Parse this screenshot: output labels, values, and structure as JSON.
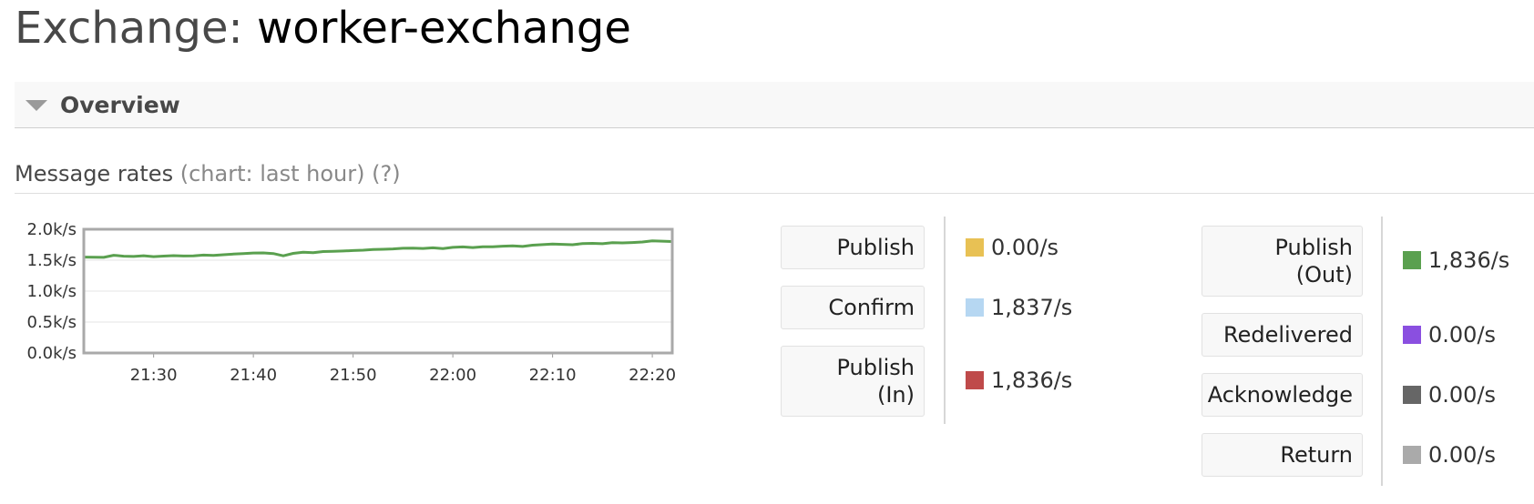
{
  "page": {
    "title_prefix": "Exchange:",
    "title_name": "worker-exchange"
  },
  "overview": {
    "label": "Overview"
  },
  "message_rates": {
    "label": "Message rates",
    "chart_hint": "(chart: last hour)",
    "help": "(?)"
  },
  "chart_data": {
    "type": "line",
    "x": [
      "21:23",
      "21:24",
      "21:25",
      "21:26",
      "21:27",
      "21:28",
      "21:29",
      "21:30",
      "21:31",
      "21:32",
      "21:33",
      "21:34",
      "21:35",
      "21:36",
      "21:37",
      "21:38",
      "21:39",
      "21:40",
      "21:41",
      "21:42",
      "21:43",
      "21:44",
      "21:45",
      "21:46",
      "21:47",
      "21:48",
      "21:49",
      "21:50",
      "21:51",
      "21:52",
      "21:53",
      "21:54",
      "21:55",
      "21:56",
      "21:57",
      "21:58",
      "21:59",
      "22:00",
      "22:01",
      "22:02",
      "22:03",
      "22:04",
      "22:05",
      "22:06",
      "22:07",
      "22:08",
      "22:09",
      "22:10",
      "22:11",
      "22:12",
      "22:13",
      "22:14",
      "22:15",
      "22:16",
      "22:17",
      "22:18",
      "22:19",
      "22:20",
      "22:21",
      "22:22"
    ],
    "series": [
      {
        "color": "#5aa04f",
        "values": [
          1550,
          1548,
          1546,
          1580,
          1565,
          1560,
          1572,
          1558,
          1566,
          1574,
          1568,
          1570,
          1582,
          1576,
          1588,
          1598,
          1608,
          1616,
          1618,
          1608,
          1570,
          1610,
          1630,
          1620,
          1640,
          1642,
          1648,
          1656,
          1662,
          1672,
          1676,
          1682,
          1692,
          1694,
          1690,
          1700,
          1688,
          1708,
          1714,
          1704,
          1716,
          1718,
          1726,
          1732,
          1722,
          1742,
          1752,
          1760,
          1756,
          1750,
          1768,
          1772,
          1766,
          1782,
          1780,
          1786,
          1794,
          1812,
          1808,
          1802
        ]
      }
    ],
    "xticks": [
      "21:30",
      "21:40",
      "21:50",
      "22:00",
      "22:10",
      "22:20"
    ],
    "yticks": [
      "0.0k/s",
      "0.5k/s",
      "1.0k/s",
      "1.5k/s",
      "2.0k/s"
    ],
    "ylim": [
      0,
      2000
    ],
    "grid": true,
    "legend": "none"
  },
  "metrics_left": [
    {
      "label_lines": [
        "Publish"
      ],
      "value": "0.00/s",
      "color": "#e8c154"
    },
    {
      "label_lines": [
        "Confirm"
      ],
      "value": "1,837/s",
      "color": "#b6d7f2"
    },
    {
      "label_lines": [
        "Publish",
        "(In)"
      ],
      "value": "1,836/s",
      "color": "#bf4a4a"
    }
  ],
  "metrics_right": [
    {
      "label_lines": [
        "Publish",
        "(Out)"
      ],
      "value": "1,836/s",
      "color": "#5aa04f"
    },
    {
      "label_lines": [
        "Redelivered"
      ],
      "value": "0.00/s",
      "color": "#8a4fe0"
    },
    {
      "label_lines": [
        "Acknowledge"
      ],
      "value": "0.00/s",
      "color": "#666666"
    },
    {
      "label_lines": [
        "Return"
      ],
      "value": "0.00/s",
      "color": "#aaaaaa"
    }
  ]
}
